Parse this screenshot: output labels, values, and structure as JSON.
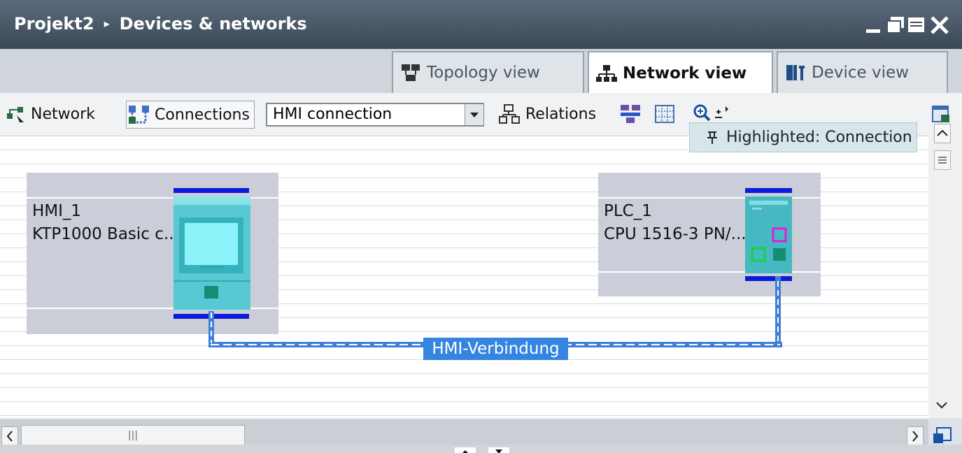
{
  "window": {
    "project": "Projekt2",
    "breadcrumb_arrow": "▸",
    "section": "Devices & networks"
  },
  "tabs": [
    {
      "label": "Topology view",
      "icon": "topology-view-icon"
    },
    {
      "label": "Network view",
      "icon": "network-view-icon",
      "active": true
    },
    {
      "label": "Device view",
      "icon": "device-view-icon"
    }
  ],
  "toolbar": {
    "network_label": "Network",
    "connections_label": "Connections",
    "connection_type": "HMI connection",
    "relations_label": "Relations"
  },
  "tooltip": {
    "text": "Highlighted: Connection"
  },
  "devices": [
    {
      "name": "HMI_1",
      "type": "KTP1000 Basic c..."
    },
    {
      "name": "PLC_1",
      "type": "CPU 1516-3 PN/..."
    }
  ],
  "connection": {
    "label": "HMI-Verbindung"
  },
  "colors": {
    "titlebar": "#44515f",
    "bus": "#0a1cd8",
    "connection": "#3585e0",
    "device": "#56c9d3"
  },
  "scrollbar": {
    "grip": "|||"
  }
}
